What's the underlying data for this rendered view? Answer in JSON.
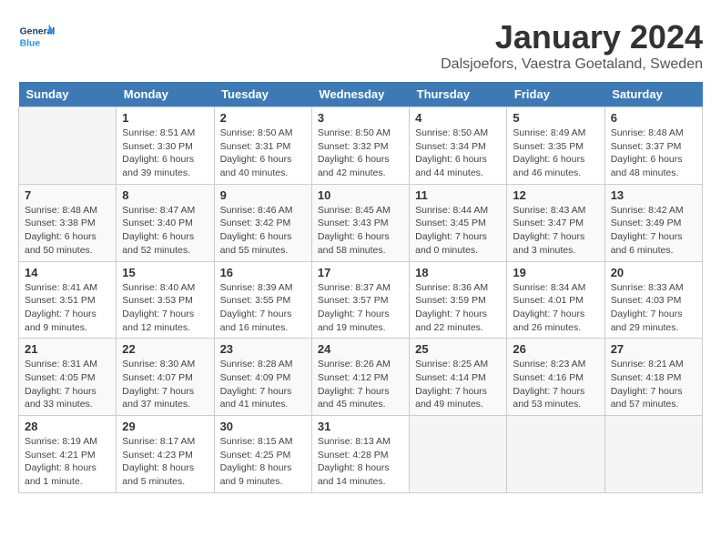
{
  "header": {
    "logo_general": "General",
    "logo_blue": "Blue",
    "month_year": "January 2024",
    "location": "Dalsjoefors, Vaestra Goetaland, Sweden"
  },
  "weekdays": [
    "Sunday",
    "Monday",
    "Tuesday",
    "Wednesday",
    "Thursday",
    "Friday",
    "Saturday"
  ],
  "weeks": [
    [
      {
        "day": "",
        "info": ""
      },
      {
        "day": "1",
        "info": "Sunrise: 8:51 AM\nSunset: 3:30 PM\nDaylight: 6 hours\nand 39 minutes."
      },
      {
        "day": "2",
        "info": "Sunrise: 8:50 AM\nSunset: 3:31 PM\nDaylight: 6 hours\nand 40 minutes."
      },
      {
        "day": "3",
        "info": "Sunrise: 8:50 AM\nSunset: 3:32 PM\nDaylight: 6 hours\nand 42 minutes."
      },
      {
        "day": "4",
        "info": "Sunrise: 8:50 AM\nSunset: 3:34 PM\nDaylight: 6 hours\nand 44 minutes."
      },
      {
        "day": "5",
        "info": "Sunrise: 8:49 AM\nSunset: 3:35 PM\nDaylight: 6 hours\nand 46 minutes."
      },
      {
        "day": "6",
        "info": "Sunrise: 8:48 AM\nSunset: 3:37 PM\nDaylight: 6 hours\nand 48 minutes."
      }
    ],
    [
      {
        "day": "7",
        "info": "Sunrise: 8:48 AM\nSunset: 3:38 PM\nDaylight: 6 hours\nand 50 minutes."
      },
      {
        "day": "8",
        "info": "Sunrise: 8:47 AM\nSunset: 3:40 PM\nDaylight: 6 hours\nand 52 minutes."
      },
      {
        "day": "9",
        "info": "Sunrise: 8:46 AM\nSunset: 3:42 PM\nDaylight: 6 hours\nand 55 minutes."
      },
      {
        "day": "10",
        "info": "Sunrise: 8:45 AM\nSunset: 3:43 PM\nDaylight: 6 hours\nand 58 minutes."
      },
      {
        "day": "11",
        "info": "Sunrise: 8:44 AM\nSunset: 3:45 PM\nDaylight: 7 hours\nand 0 minutes."
      },
      {
        "day": "12",
        "info": "Sunrise: 8:43 AM\nSunset: 3:47 PM\nDaylight: 7 hours\nand 3 minutes."
      },
      {
        "day": "13",
        "info": "Sunrise: 8:42 AM\nSunset: 3:49 PM\nDaylight: 7 hours\nand 6 minutes."
      }
    ],
    [
      {
        "day": "14",
        "info": "Sunrise: 8:41 AM\nSunset: 3:51 PM\nDaylight: 7 hours\nand 9 minutes."
      },
      {
        "day": "15",
        "info": "Sunrise: 8:40 AM\nSunset: 3:53 PM\nDaylight: 7 hours\nand 12 minutes."
      },
      {
        "day": "16",
        "info": "Sunrise: 8:39 AM\nSunset: 3:55 PM\nDaylight: 7 hours\nand 16 minutes."
      },
      {
        "day": "17",
        "info": "Sunrise: 8:37 AM\nSunset: 3:57 PM\nDaylight: 7 hours\nand 19 minutes."
      },
      {
        "day": "18",
        "info": "Sunrise: 8:36 AM\nSunset: 3:59 PM\nDaylight: 7 hours\nand 22 minutes."
      },
      {
        "day": "19",
        "info": "Sunrise: 8:34 AM\nSunset: 4:01 PM\nDaylight: 7 hours\nand 26 minutes."
      },
      {
        "day": "20",
        "info": "Sunrise: 8:33 AM\nSunset: 4:03 PM\nDaylight: 7 hours\nand 29 minutes."
      }
    ],
    [
      {
        "day": "21",
        "info": "Sunrise: 8:31 AM\nSunset: 4:05 PM\nDaylight: 7 hours\nand 33 minutes."
      },
      {
        "day": "22",
        "info": "Sunrise: 8:30 AM\nSunset: 4:07 PM\nDaylight: 7 hours\nand 37 minutes."
      },
      {
        "day": "23",
        "info": "Sunrise: 8:28 AM\nSunset: 4:09 PM\nDaylight: 7 hours\nand 41 minutes."
      },
      {
        "day": "24",
        "info": "Sunrise: 8:26 AM\nSunset: 4:12 PM\nDaylight: 7 hours\nand 45 minutes."
      },
      {
        "day": "25",
        "info": "Sunrise: 8:25 AM\nSunset: 4:14 PM\nDaylight: 7 hours\nand 49 minutes."
      },
      {
        "day": "26",
        "info": "Sunrise: 8:23 AM\nSunset: 4:16 PM\nDaylight: 7 hours\nand 53 minutes."
      },
      {
        "day": "27",
        "info": "Sunrise: 8:21 AM\nSunset: 4:18 PM\nDaylight: 7 hours\nand 57 minutes."
      }
    ],
    [
      {
        "day": "28",
        "info": "Sunrise: 8:19 AM\nSunset: 4:21 PM\nDaylight: 8 hours\nand 1 minute."
      },
      {
        "day": "29",
        "info": "Sunrise: 8:17 AM\nSunset: 4:23 PM\nDaylight: 8 hours\nand 5 minutes."
      },
      {
        "day": "30",
        "info": "Sunrise: 8:15 AM\nSunset: 4:25 PM\nDaylight: 8 hours\nand 9 minutes."
      },
      {
        "day": "31",
        "info": "Sunrise: 8:13 AM\nSunset: 4:28 PM\nDaylight: 8 hours\nand 14 minutes."
      },
      {
        "day": "",
        "info": ""
      },
      {
        "day": "",
        "info": ""
      },
      {
        "day": "",
        "info": ""
      }
    ]
  ]
}
